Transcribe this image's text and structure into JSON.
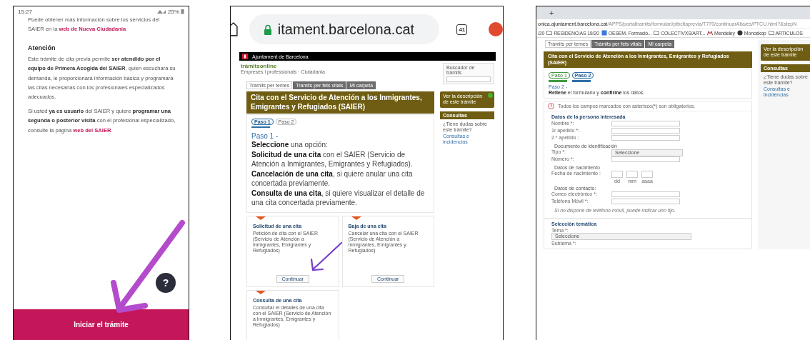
{
  "phone_app": {
    "status_bar": {
      "time": "15:27",
      "battery": "25%"
    },
    "paragraphs": [
      {
        "kind": "text",
        "text": "Puede obtener más información sobre los servicios del SAIER en la ",
        "link": "web de Nueva Ciudadanía"
      },
      {
        "kind": "heading",
        "text": "Atención"
      },
      {
        "kind": "text",
        "text": "Este trámite de cita previa permite **ser atendido por el equipo de Primera Acogida del SAIER**, quien escuchará su demanda, le proporcionará información básica y programará las citas necesarias con los profesionales especializados adecuados."
      },
      {
        "kind": "text",
        "text": "Si usted **ya es usuario** del SAIER y quiere **programar una segunda o posterior visita** con el profesional especializado, consulte la página ",
        "link": "web del SAIER",
        "after": "."
      }
    ],
    "help_button": "?",
    "start_button": "Iniciar el trámite"
  },
  "mobile_browser": {
    "url": "itament.barcelona.cat",
    "tab_count": "41",
    "page": {
      "header": "Ajuntament de Barcelona",
      "logo": "tràmitsonline",
      "logo_sub": "Empreses i professionals · Ciutadania",
      "search_label": "Buscador de tràmits",
      "tabs": [
        {
          "label": "Tràmits per temes",
          "selected": true
        },
        {
          "label": "Tràmits per fets vitals",
          "selected": false
        },
        {
          "label": "Mi carpeta",
          "selected": false
        }
      ],
      "title": "Cita con el Servicio de Atención a los Inmigrantes, Emigrantes y Refugiados (SAIER)",
      "steps": [
        {
          "label": "Paso 1",
          "done": false,
          "selected": true
        },
        {
          "label": "Paso 2",
          "done": false,
          "selected": false
        }
      ],
      "step_heading": "Paso 1 -",
      "lines": [
        "**Seleccione** una opción:",
        "**Solicitud de una cita** con el SAIER (Servicio de Atención a Inmigrantes, Emigrantes y Refugiados).",
        "**Cancelación de una cita**, si quiere anular una cita concertada previamente.",
        "**Consulta de una cita**, si quiere visualizar el detalle de una cita concertada previamente."
      ],
      "options": [
        {
          "title": "Solicitud de una cita",
          "text": "Petición de cita con el SAIER (Servicio de Atención a Inmigrantes, Emigrantes y Refugiados)",
          "button": "Continuar"
        },
        {
          "title": "Baja de una cita",
          "text": "Cancelar una cita con el SAIER (Servicio de Atención a Inmigrantes, Emigrantes y Refugiados)",
          "button": "Continuar"
        },
        {
          "title": "Consulta de una cita",
          "text": "Consultar el detalles de una cita con el SAIER (Servicio de Atención a Inmigrantes, Emigrantes y Refugiados)"
        }
      ],
      "sidebar": {
        "description_link": "Ver la descripción de este trámite",
        "consultas_title": "Consultas",
        "question": "¿Tiene dudas sobre este trámite?",
        "link": "Consultas e incidencias"
      }
    }
  },
  "desktop_browser": {
    "new_tab": "+",
    "url_host": "onica.ajuntament.barcelona.cat",
    "url_path": "/APPS/portaltramits/formulari/ptbcitaprevia/T770/continuarAlta/es/PTCU.html?&stepN",
    "bookmarks": [
      {
        "kind": "text",
        "label": "/20"
      },
      {
        "kind": "folder",
        "label": "RESIDENCIAS 19/20"
      },
      {
        "kind": "app",
        "label": "OESEM. Formació..."
      },
      {
        "kind": "folder",
        "label": "COLECTIVXS/ART..."
      },
      {
        "kind": "mendeley",
        "label": "Mendeley"
      },
      {
        "kind": "globe",
        "label": "Monoskop"
      },
      {
        "kind": "folder",
        "label": "ARTICULOS"
      }
    ],
    "page": {
      "tabs": [
        {
          "label": "Tràmits per temes",
          "selected": true
        },
        {
          "label": "Tràmits per fets vitals",
          "selected": false
        },
        {
          "label": "Mi carpeta",
          "selected": false
        }
      ],
      "title": "Cita con el Servicio de Atención a los Inmigrantes, Emigrantes y Refugiados (SAIER)",
      "steps": [
        {
          "label": "Paso 1",
          "done": true,
          "selected": false
        },
        {
          "label": "Paso 2",
          "done": false,
          "selected": true
        }
      ],
      "step_heading": "Paso 2 -",
      "instruction": "**Rellene** el formulario y **confirme** los datos.",
      "notice": "Todos los campos marcados con asterisco(*) son obligatorios.",
      "sections": [
        {
          "title": "Datos de la persona interesada",
          "items": [
            {
              "kind": "textfield",
              "label": "Nombre *:"
            },
            {
              "kind": "textfield",
              "label": "1r apellido *:"
            },
            {
              "kind": "textfield",
              "label": "2.º apellido :"
            },
            {
              "kind": "subheading",
              "text": "Documento de identificación"
            },
            {
              "kind": "select",
              "label": "Tipo *:",
              "value": "Seleccione"
            },
            {
              "kind": "textfield",
              "label": "Número *:"
            },
            {
              "kind": "subheading",
              "text": "Datos de nacimiento"
            },
            {
              "kind": "date",
              "label": "Fecha de nacimiento :",
              "parts": [
                "dd",
                "mm",
                "aaaa"
              ]
            },
            {
              "kind": "subheading",
              "text": "Datos de contacto:"
            },
            {
              "kind": "textfield",
              "label": "Correo electrónico *:"
            },
            {
              "kind": "textfield",
              "label": "Teléfono Móvil *:"
            },
            {
              "kind": "note",
              "text": "Si no dispone de teléfono móvil, puede indicar uno fijo."
            }
          ]
        },
        {
          "title": "Selección temática",
          "items": [
            {
              "kind": "stacked",
              "label": "Tema *:",
              "value": "Seleccione"
            },
            {
              "kind": "label",
              "text": "Subtema *:"
            }
          ]
        }
      ],
      "sidebar": {
        "description_link": "Ver la descripción de este trámite",
        "consultas_title": "Consultas",
        "question": "¿Tiene dudas sobre este trámite?",
        "link": "Consultas e incidencias"
      }
    }
  }
}
